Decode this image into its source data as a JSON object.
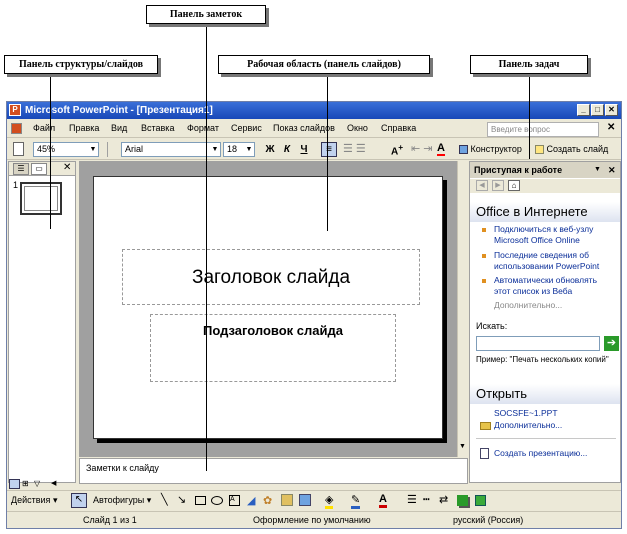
{
  "callouts": {
    "notes_pane": "Панель заметок",
    "outline_pane": "Панель структуры/слайдов",
    "work_area": "Рабочая область (панель слайдов)",
    "task_pane": "Панель задач"
  },
  "window": {
    "title": "Microsoft PowerPoint - [Презентация1]",
    "app_icon": "powerpoint-icon"
  },
  "menu": {
    "items": [
      "Файл",
      "Правка",
      "Вид",
      "Вставка",
      "Формат",
      "Сервис",
      "Показ слайдов",
      "Окно",
      "Справка"
    ],
    "question_placeholder": "Введите вопрос"
  },
  "toolbar": {
    "zoom": "45%",
    "font": "Arial",
    "size": "18",
    "bold": "Ж",
    "italic": "К",
    "underline": "Ч",
    "designer": "Конструктор",
    "new_slide": "Создать слайд"
  },
  "left_pane": {
    "slide_number": "1"
  },
  "slide": {
    "title": "Заголовок слайда",
    "subtitle": "Подзаголовок слайда"
  },
  "notes": {
    "text": "Заметки к слайду"
  },
  "task_pane": {
    "header": "Приступая к работе",
    "office_online_title": "Office в Интернете",
    "links": [
      "Подключиться к веб-узлу Microsoft Office Online",
      "Последние сведения об использовании PowerPoint",
      "Автоматически обновлять этот список из Веба"
    ],
    "more": "Дополнительно...",
    "search_label": "Искать:",
    "example": "Пример: \"Печать нескольких копий\"",
    "open_title": "Открыть",
    "recent_file": "SOCSFE~1.PPT",
    "open_more": "Дополнительно...",
    "create": "Создать презентацию..."
  },
  "drawing_toolbar": {
    "actions": "Действия",
    "autoshapes": "Автофигуры"
  },
  "status": {
    "slide": "Слайд 1 из 1",
    "design": "Оформление по умолчанию",
    "language": "русский (Россия)"
  },
  "colors": {
    "title_bar": "#1848b8",
    "link": "#0a2e99",
    "bullet": "#e09020",
    "go_button": "#2a9a2a"
  }
}
